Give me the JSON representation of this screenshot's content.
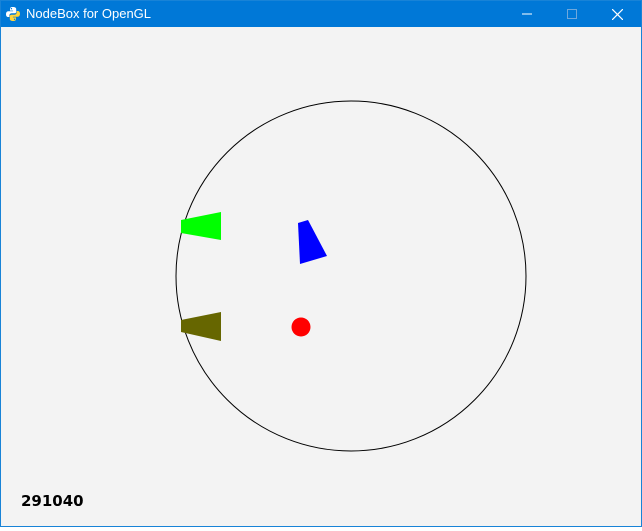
{
  "window": {
    "title": "NodeBox for OpenGL",
    "icon": "python-icon",
    "controls": [
      "minimize-icon",
      "maximize-icon",
      "close-icon"
    ],
    "titlebar_color": "#0078d7",
    "canvas_color": "#f3f3f3"
  },
  "scene": {
    "counter": "291040",
    "circle_color": "#000000",
    "shapes": [
      {
        "name": "green-trapezoid",
        "color": "#00ff00"
      },
      {
        "name": "olive-trapezoid",
        "color": "#666600"
      },
      {
        "name": "blue-quadrilateral",
        "color": "#0000ff"
      },
      {
        "name": "red-dot",
        "color": "#ff0000"
      }
    ]
  }
}
